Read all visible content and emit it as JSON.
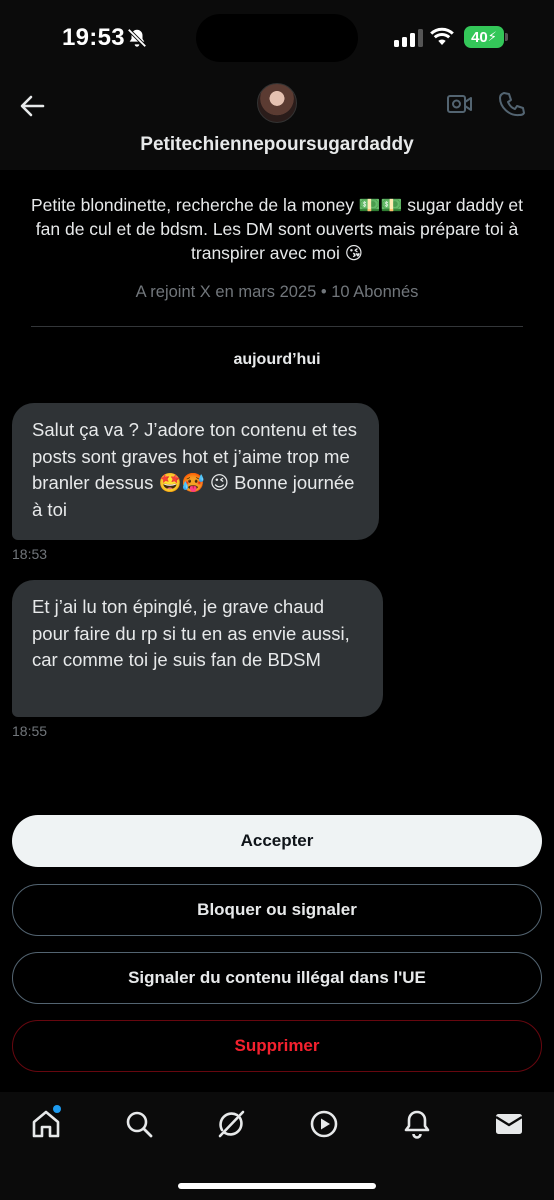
{
  "status_bar": {
    "time": "19:53",
    "battery": "40",
    "icons": [
      "bell-slash-icon",
      "cellular-signal-icon",
      "wifi-icon",
      "battery-charging-icon"
    ]
  },
  "header": {
    "username": "Petitechiennepoursugardaddy",
    "icons": [
      "back-arrow-icon",
      "avatar",
      "video-camera-icon",
      "phone-icon"
    ]
  },
  "profile": {
    "bio": "Petite blondinette, recherche de la money 💵💵 sugar daddy et fan de cul et de bdsm. Les DM sont ouverts mais prépare toi à transpirer avec moi 😘",
    "joined": "A rejoint X en mars 2025 • 10 Abonnés"
  },
  "conversation": {
    "day_label": "aujourd’hui",
    "messages": [
      {
        "text": "Salut ça va ? J’adore ton contenu et tes posts sont graves hot et j’aime trop me branler dessus 🤩🥵 😉 Bonne journée à toi",
        "time": "18:53"
      },
      {
        "text": "Et j’ai lu ton épinglé, je grave chaud pour faire du rp si tu en as envie aussi, car comme toi je suis fan de BDSM",
        "time": "18:55"
      }
    ]
  },
  "actions": {
    "accept": "Accepter",
    "block": "Bloquer ou signaler",
    "report_illegal": "Signaler du contenu illégal dans l'UE",
    "delete": "Supprimer"
  },
  "bottom_nav": {
    "items": [
      "home-icon",
      "search-icon",
      "grok-icon",
      "video-play-icon",
      "notifications-bell-icon",
      "messages-envelope-icon"
    ],
    "home_has_notification": true
  },
  "colors": {
    "background": "#000000",
    "bubble": "#2f3336",
    "muted_text": "#71767b",
    "accept_button": "#eff3f4",
    "danger": "#f4212e",
    "accent": "#1d9bf0",
    "battery": "#34c759"
  }
}
